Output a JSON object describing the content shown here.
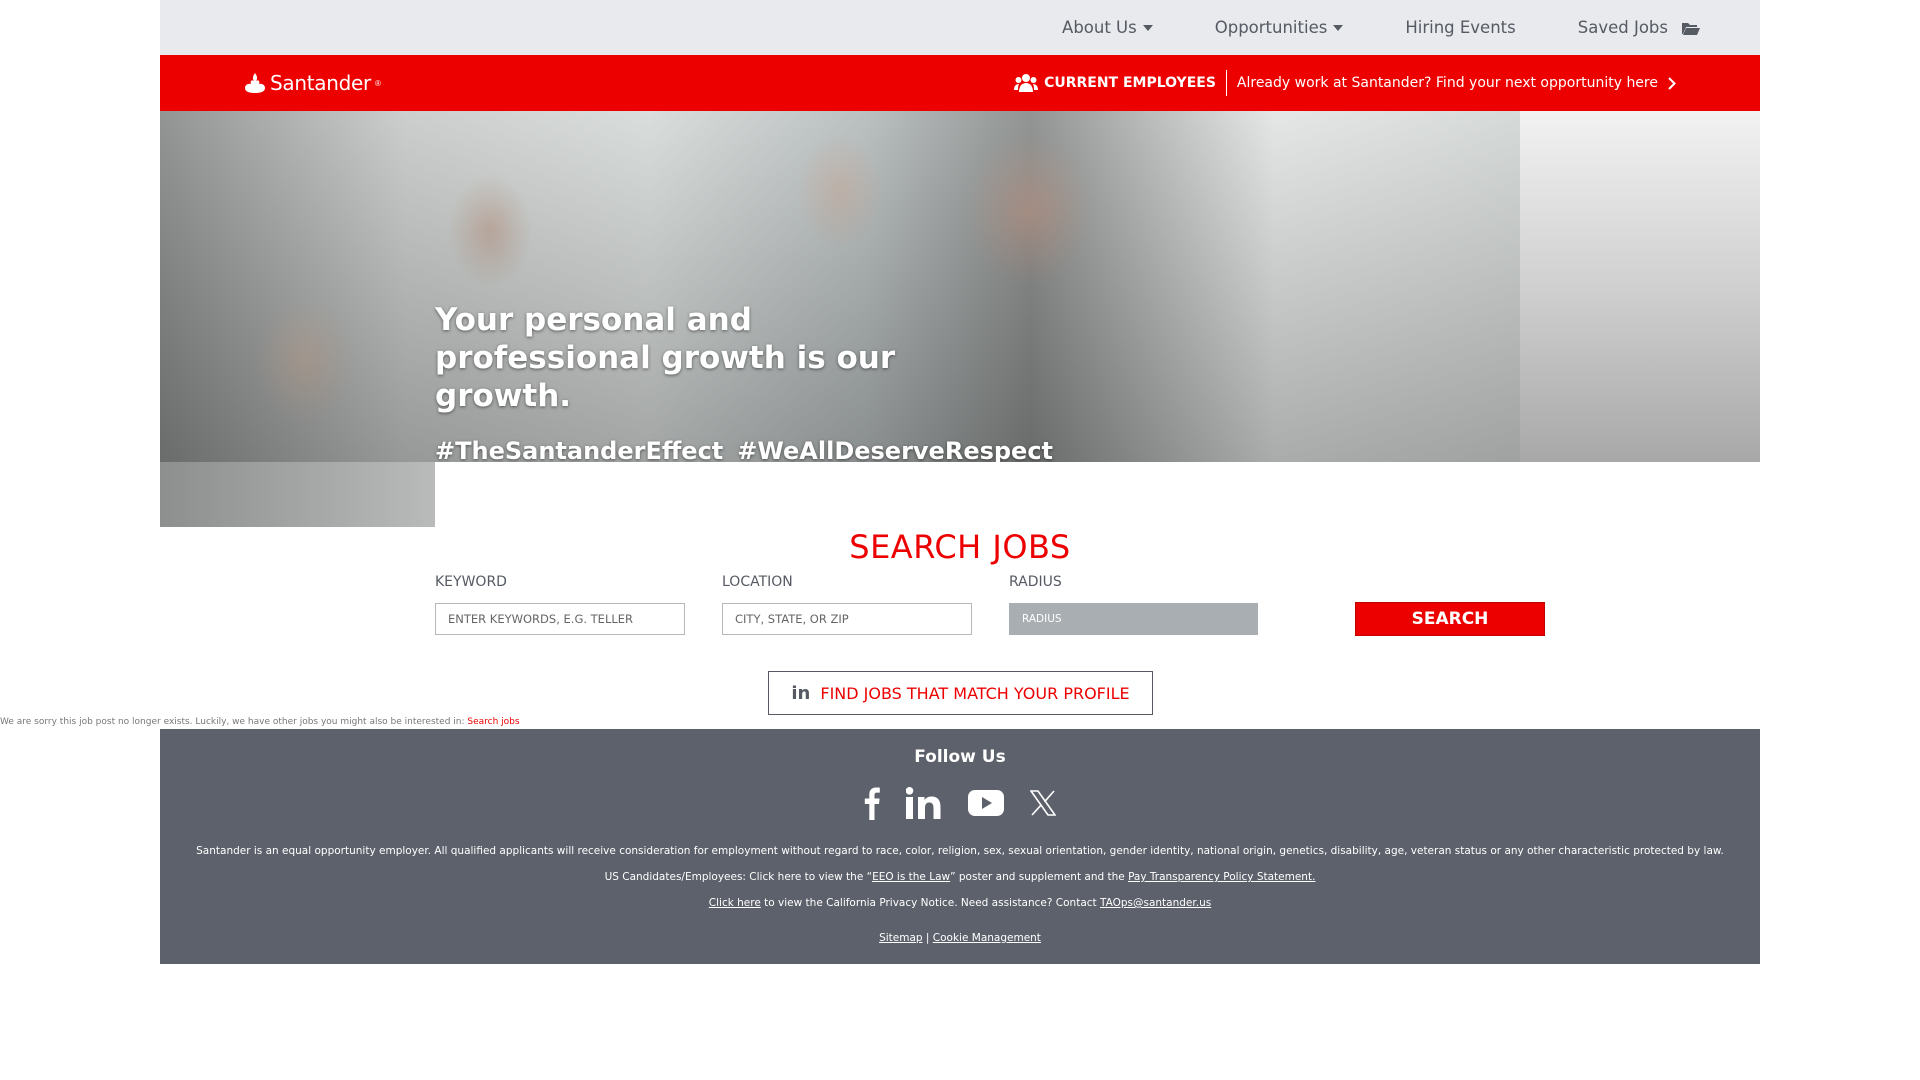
{
  "topnav": {
    "about": "About Us",
    "opportunities": "Opportunities",
    "hiring_events": "Hiring Events",
    "saved_jobs": "Saved Jobs"
  },
  "banner": {
    "logo_text": "Santander",
    "logo_reg": "®",
    "current_employees": "CURRENT EMPLOYEES",
    "current_employees_link": "Already work at Santander? Find your next opportunity here"
  },
  "hero": {
    "headline": "Your personal and professional growth is our growth.",
    "tag1": "#TheSantanderEffect",
    "tag2": "#WeAllDeserveRespect"
  },
  "search": {
    "title": "SEARCH JOBS",
    "keyword_label": "KEYWORD",
    "keyword_placeholder": "ENTER KEYWORDS, E.G. TELLER",
    "location_label": "LOCATION",
    "location_placeholder": "CITY, STATE, OR ZIP",
    "radius_label": "RADIUS",
    "radius_value": "RADIUS",
    "button": "SEARCH",
    "profile_button": "FIND JOBS THAT MATCH YOUR PROFILE"
  },
  "notice": {
    "text": "We are sorry this job post no longer exists. Luckily, we have other jobs you might also be interested in:",
    "link": "Search jobs"
  },
  "footer": {
    "follow": "Follow Us",
    "eeo_text": "Santander is an equal opportunity employer. All qualified applicants will receive consideration for employment without regard to race, color, religion, sex, sexual orientation, gender identity, national origin, genetics, disability, age, veteran status or any other characteristic protected by law.",
    "us_prefix": "US Candidates/Employees: Click here to view the “",
    "eeo_link": "EEO is the Law",
    "us_middle": "” poster and supplement and the ",
    "pay_link": "Pay Transparency Policy Statement.",
    "click_here": "Click here",
    "privacy_text": " to view the California Privacy Notice. Need assistance? Contact ",
    "email": "TAOps@santander.us",
    "sitemap": "Sitemap",
    "separator": " | ",
    "cookie": "Cookie Management"
  },
  "colors": {
    "brand_red": "#ec0000",
    "nav_bg": "#e8eaed",
    "footer_bg": "#5d616b",
    "text_gray": "#555a63"
  },
  "icons": [
    "caret-down-icon",
    "folder-icon",
    "santander-flame-icon",
    "users-icon",
    "chevron-right-icon",
    "linkedin-icon",
    "facebook-icon",
    "youtube-icon",
    "x-icon"
  ]
}
